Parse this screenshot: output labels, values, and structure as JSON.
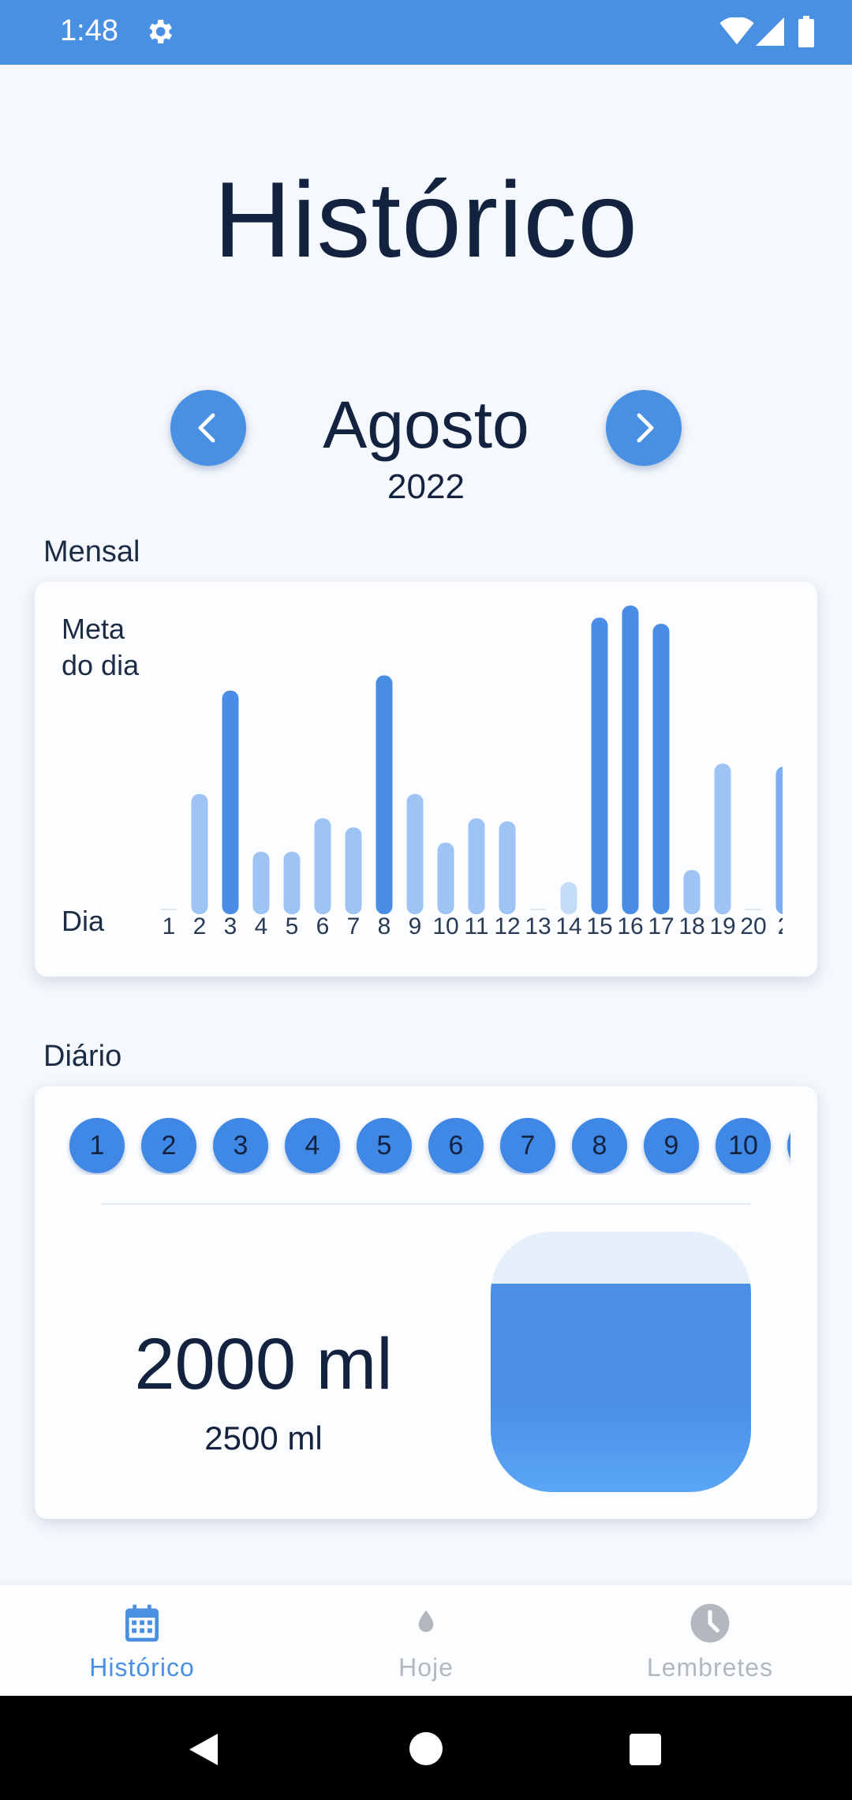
{
  "status_bar": {
    "time": "1:48",
    "gear_icon": "gear-icon",
    "wifi_icon": "wifi-icon",
    "signal_icon": "signal-icon",
    "battery_icon": "battery-icon",
    "color": "#4a90e2"
  },
  "page_title": "Histórico",
  "month_nav": {
    "month": "Agosto",
    "year": "2022",
    "prev_icon": "chevron-left-icon",
    "next_icon": "chevron-right-icon"
  },
  "monthly_section": {
    "label": "Mensal"
  },
  "chart_data": {
    "type": "bar",
    "y_label_line1": "Meta",
    "y_label_line2": "do dia",
    "x_label": "Dia",
    "categories": [
      "1",
      "2",
      "3",
      "4",
      "5",
      "6",
      "7",
      "8",
      "9",
      "10",
      "11",
      "12",
      "13",
      "14",
      "15",
      "16",
      "17",
      "18",
      "19",
      "20",
      "2"
    ],
    "values": [
      0,
      0.38,
      0.72,
      0.19,
      0.19,
      0.3,
      0.27,
      0.77,
      0.38,
      0.22,
      0.3,
      0.29,
      0,
      0.09,
      0.96,
      1.0,
      0.94,
      0.13,
      0.48,
      0,
      0.47
    ],
    "goal_reached": [
      false,
      false,
      true,
      false,
      false,
      false,
      false,
      true,
      false,
      false,
      false,
      false,
      false,
      false,
      true,
      true,
      true,
      false,
      false,
      false,
      false
    ],
    "ylim": [
      0,
      1
    ],
    "colors": {
      "reached": "#4a8de6",
      "below": "#9dc4f4",
      "low": "#c4dcf7",
      "mid": "#7aaef0"
    }
  },
  "daily_section": {
    "label": "Diário"
  },
  "daily": {
    "days": [
      "1",
      "2",
      "3",
      "4",
      "5",
      "6",
      "7",
      "8",
      "9",
      "10"
    ],
    "consumed": "2000 ml",
    "goal": "2500 ml",
    "fill_fraction": 0.8
  },
  "bottom_nav": {
    "items": [
      {
        "label": "Histórico",
        "icon": "calendar-icon",
        "active": true
      },
      {
        "label": "Hoje",
        "icon": "water-drop-icon",
        "active": false
      },
      {
        "label": "Lembretes",
        "icon": "clock-icon",
        "active": false
      }
    ],
    "active_color": "#4a90e2",
    "inactive_color": "#b3b8bf"
  }
}
